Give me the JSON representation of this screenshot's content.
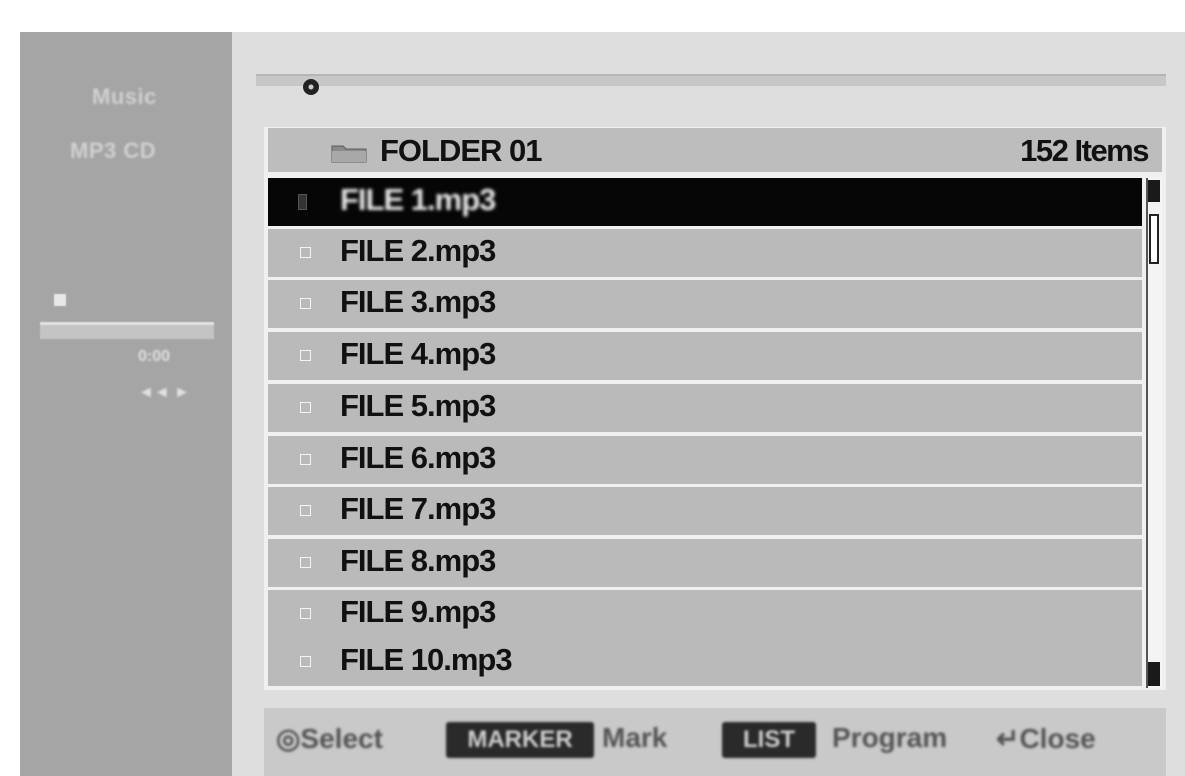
{
  "sidebar": {
    "title": "Music",
    "subtitle": "MP3 CD",
    "time": "0:00",
    "mode": "◄◄ ►"
  },
  "list": {
    "folder_name": "FOLDER 01",
    "item_count": "152 Items",
    "files": [
      "FILE 1.mp3",
      "FILE 2.mp3",
      "FILE 3.mp3",
      "FILE 4.mp3",
      "FILE 5.mp3",
      "FILE 6.mp3",
      "FILE 7.mp3",
      "FILE 8.mp3",
      "FILE 9.mp3",
      "FILE 10.mp3"
    ],
    "selected_index": 0
  },
  "help": {
    "select": "◎Select",
    "mark_key": "MARKER",
    "mark": "Mark",
    "list_key": "LIST",
    "program": "Program",
    "close": "↵Close"
  },
  "icons": {
    "folder": "folder-icon",
    "disc": "disc-icon",
    "checkbox": "checkbox-icon"
  }
}
